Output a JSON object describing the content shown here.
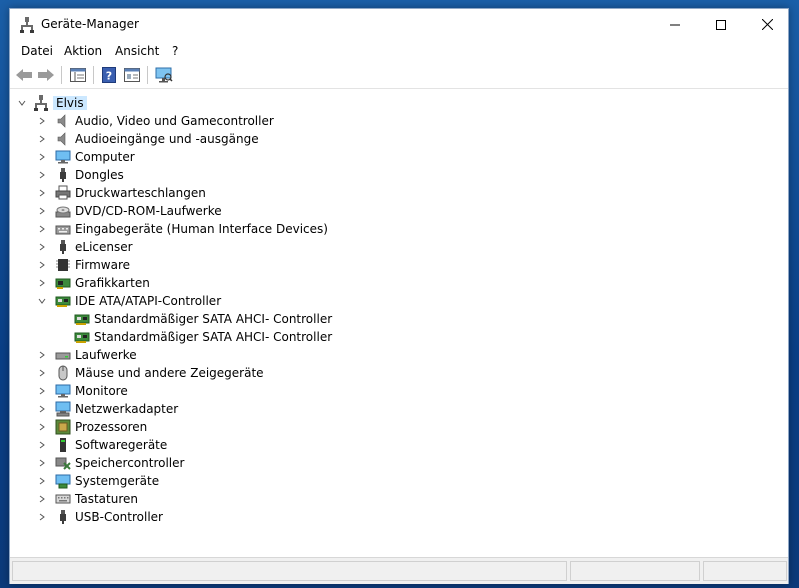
{
  "window": {
    "title": "Geräte-Manager"
  },
  "menu": [
    "Datei",
    "Aktion",
    "Ansicht",
    "?"
  ],
  "toolbar": {
    "buttons": [
      "back-arrow-icon",
      "forward-arrow-icon",
      "show-hide-tree-icon",
      "help-icon",
      "properties-view-icon",
      "monitor-scan-icon"
    ]
  },
  "tree": {
    "root": "Elvis",
    "categories": [
      {
        "label": "Audio, Video und Gamecontroller",
        "icon": "speaker-icon",
        "expanded": false
      },
      {
        "label": "Audioeingänge und -ausgänge",
        "icon": "speaker-icon",
        "expanded": false
      },
      {
        "label": "Computer",
        "icon": "computer-icon",
        "expanded": false
      },
      {
        "label": "Dongles",
        "icon": "usb-plug-icon",
        "expanded": false
      },
      {
        "label": "Druckwarteschlangen",
        "icon": "printer-icon",
        "expanded": false
      },
      {
        "label": "DVD/CD-ROM-Laufwerke",
        "icon": "disc-drive-icon",
        "expanded": false
      },
      {
        "label": "Eingabegeräte (Human Interface Devices)",
        "icon": "keyboard-device-icon",
        "expanded": false
      },
      {
        "label": "eLicenser",
        "icon": "usb-plug-icon",
        "expanded": false
      },
      {
        "label": "Firmware",
        "icon": "chip-icon",
        "expanded": false
      },
      {
        "label": "Grafikkarten",
        "icon": "display-adapter-icon",
        "expanded": false
      },
      {
        "label": "IDE ATA/ATAPI-Controller",
        "icon": "controller-card-icon",
        "expanded": true,
        "children": [
          {
            "label": "Standardmäßiger SATA AHCI- Controller",
            "icon": "controller-card-icon"
          },
          {
            "label": "Standardmäßiger SATA AHCI- Controller",
            "icon": "controller-card-icon"
          }
        ]
      },
      {
        "label": "Laufwerke",
        "icon": "hard-drive-icon",
        "expanded": false
      },
      {
        "label": "Mäuse und andere Zeigegeräte",
        "icon": "mouse-icon",
        "expanded": false
      },
      {
        "label": "Monitore",
        "icon": "monitor-icon",
        "expanded": false
      },
      {
        "label": "Netzwerkadapter",
        "icon": "network-adapter-icon",
        "expanded": false
      },
      {
        "label": "Prozessoren",
        "icon": "processor-icon",
        "expanded": false
      },
      {
        "label": "Softwaregeräte",
        "icon": "software-device-icon",
        "expanded": false
      },
      {
        "label": "Speichercontroller",
        "icon": "storage-controller-icon",
        "expanded": false
      },
      {
        "label": "Systemgeräte",
        "icon": "system-device-icon",
        "expanded": false
      },
      {
        "label": "Tastaturen",
        "icon": "keyboard-icon",
        "expanded": false
      },
      {
        "label": "USB-Controller",
        "icon": "usb-plug-icon",
        "expanded": false
      }
    ]
  },
  "colors": {
    "selection": "#cce8ff",
    "desktop": "#0a3f86"
  }
}
